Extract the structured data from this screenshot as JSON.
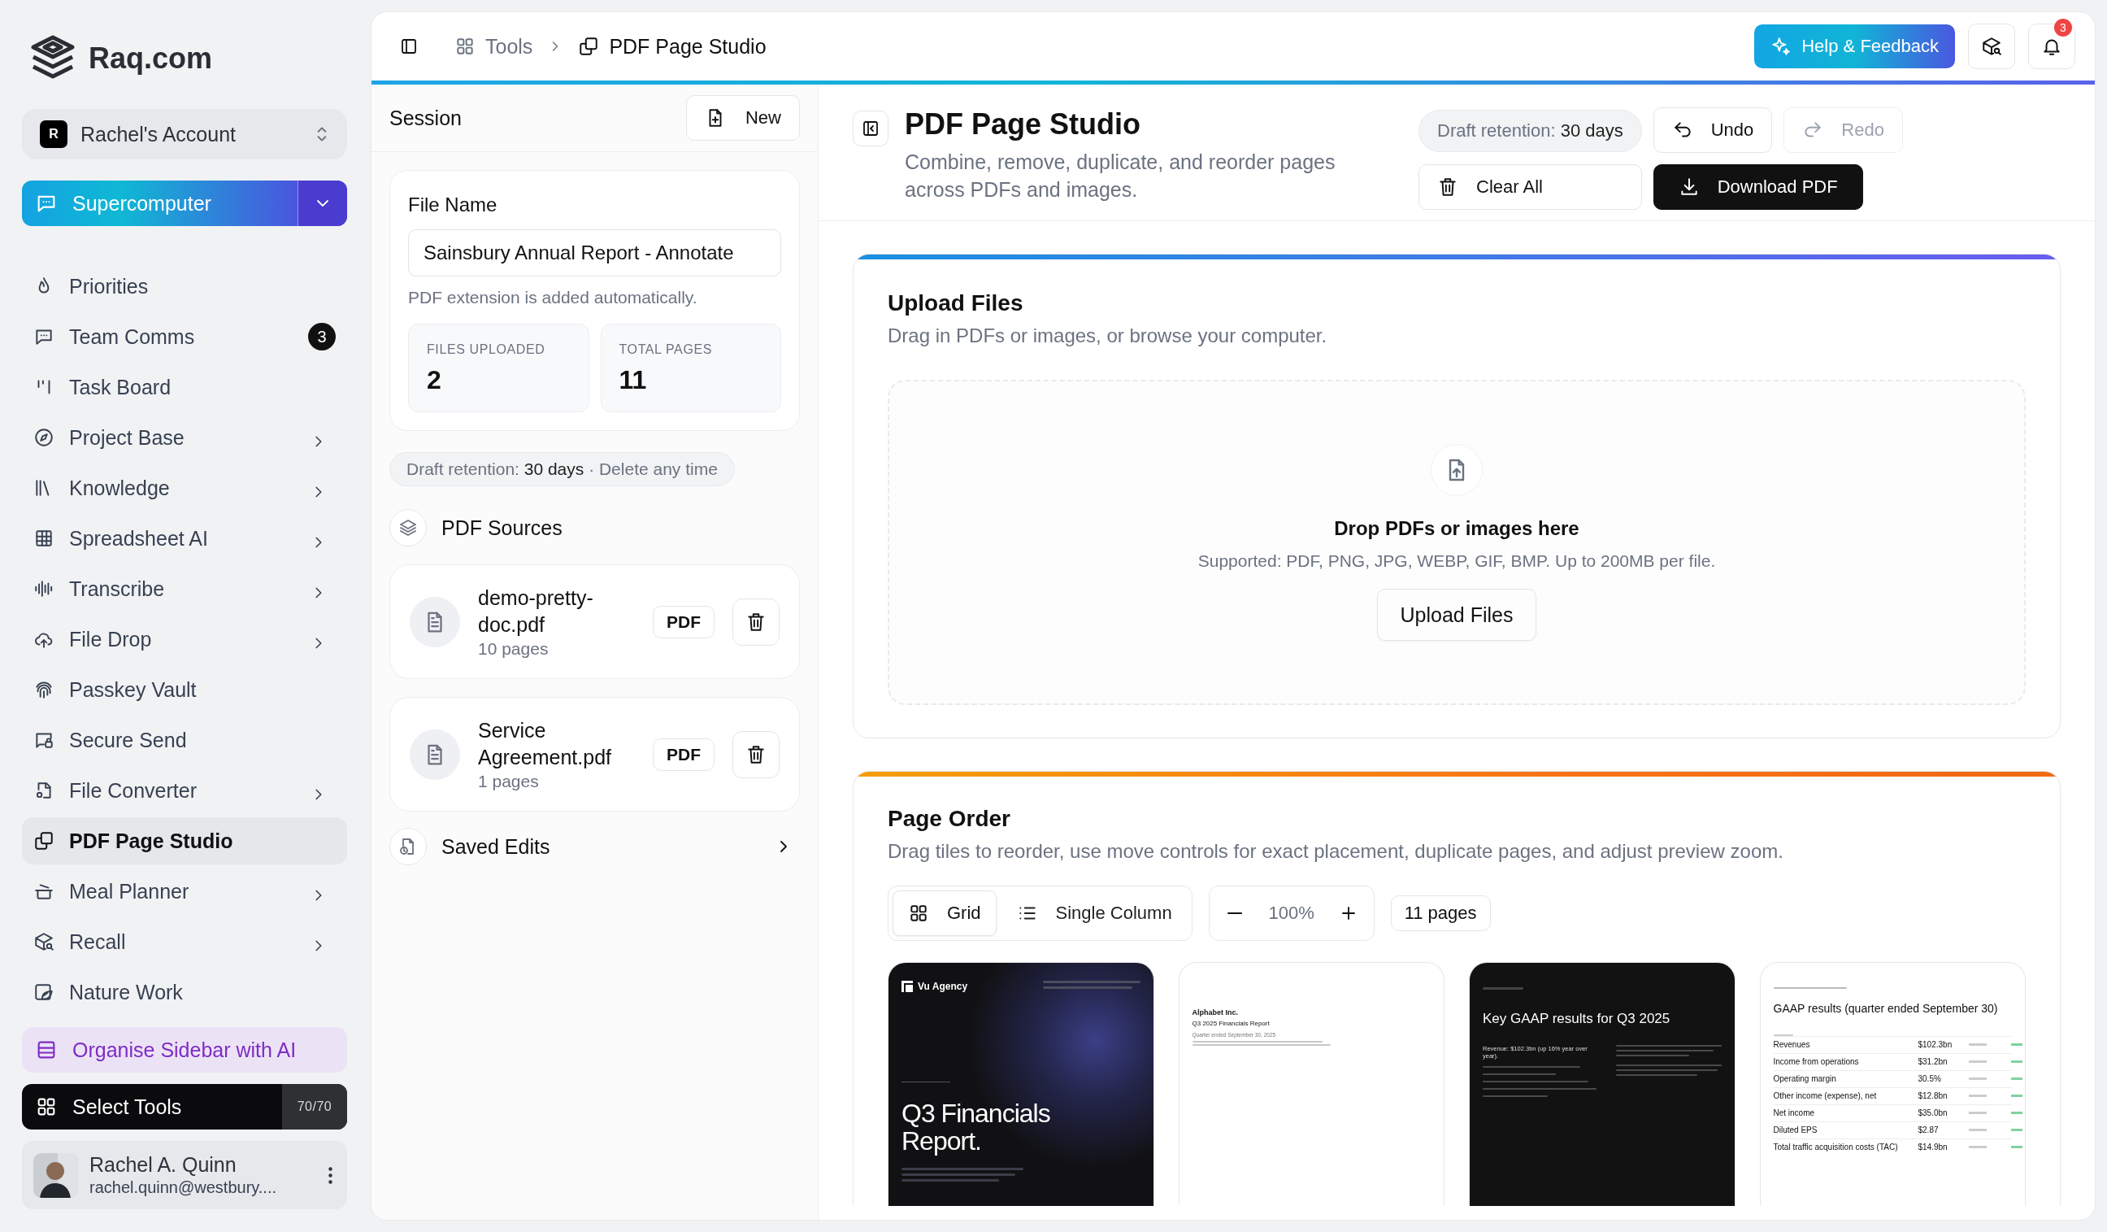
{
  "brand": {
    "name": "Raq.com"
  },
  "account": {
    "initial": "R",
    "name": "Rachel's Account"
  },
  "primary_tool": {
    "label": "Supercomputer"
  },
  "nav": [
    {
      "label": "Priorities",
      "expandable": false,
      "selected": false
    },
    {
      "label": "Team Comms",
      "expandable": false,
      "selected": false,
      "badge": "3"
    },
    {
      "label": "Task Board",
      "expandable": false,
      "selected": false
    },
    {
      "label": "Project Base",
      "expandable": true,
      "selected": false
    },
    {
      "label": "Knowledge",
      "expandable": true,
      "selected": false
    },
    {
      "label": "Spreadsheet AI",
      "expandable": true,
      "selected": false
    },
    {
      "label": "Transcribe",
      "expandable": true,
      "selected": false
    },
    {
      "label": "File Drop",
      "expandable": true,
      "selected": false
    },
    {
      "label": "Passkey Vault",
      "expandable": false,
      "selected": false
    },
    {
      "label": "Secure Send",
      "expandable": false,
      "selected": false
    },
    {
      "label": "File Converter",
      "expandable": true,
      "selected": false
    },
    {
      "label": "PDF Page Studio",
      "expandable": false,
      "selected": true
    },
    {
      "label": "Meal Planner",
      "expandable": true,
      "selected": false
    },
    {
      "label": "Recall",
      "expandable": true,
      "selected": false
    },
    {
      "label": "Nature Work",
      "expandable": false,
      "selected": false
    }
  ],
  "organise": {
    "label": "Organise Sidebar with AI"
  },
  "select_tools": {
    "label": "Select Tools",
    "count": "70/70"
  },
  "user": {
    "name": "Rachel A. Quinn",
    "email": "rachel.quinn@westbury...."
  },
  "breadcrumb": [
    {
      "label": "Tools"
    },
    {
      "label": "PDF Page Studio"
    }
  ],
  "top_actions": {
    "help": "Help & Feedback",
    "notification_count": "3"
  },
  "session": {
    "title": "Session",
    "new_button": "New",
    "file_name_label": "File Name",
    "file_name_value": "Sainsbury Annual Report - Annotate",
    "hint": "PDF extension is added automatically.",
    "stats": [
      {
        "label": "FILES UPLOADED",
        "value": "2"
      },
      {
        "label": "TOTAL PAGES",
        "value": "11"
      }
    ],
    "retention": "Draft retention: **30 days** · Delete any time",
    "sources_title": "PDF Sources",
    "sources": [
      {
        "name": "demo-pretty-doc.pdf",
        "pages": "10 pages",
        "type": "PDF"
      },
      {
        "name": "Service Agreement.pdf",
        "pages": "1 pages",
        "type": "PDF"
      }
    ],
    "saved_edits": "Saved Edits"
  },
  "header": {
    "title": "PDF Page Studio",
    "subtitle": "Combine, remove, duplicate, and reorder pages across PDFs and images.",
    "retention": "Draft retention: **30 days**",
    "buttons": [
      {
        "kind": "undo",
        "label": "Undo",
        "disabled": false
      },
      {
        "kind": "redo",
        "label": "Redo",
        "disabled": true
      },
      {
        "kind": "clear",
        "label": "Clear All",
        "disabled": false
      },
      {
        "kind": "download",
        "label": "Download PDF",
        "disabled": false
      }
    ]
  },
  "upload": {
    "title": "Upload Files",
    "subtitle": "Drag in PDFs or images, or browse your computer.",
    "drop_title": "Drop PDFs or images here",
    "supported": "Supported: PDF, PNG, JPG, WEBP, GIF, BMP. Up to 200MB per file.",
    "button": "Upload Files"
  },
  "page_order": {
    "title": "Page Order",
    "subtitle": "Drag tiles to reorder, use move controls for exact placement, duplicate pages, and adjust preview zoom.",
    "views": [
      {
        "label": "Grid",
        "selected": true
      },
      {
        "label": "Single Column",
        "selected": false
      }
    ],
    "zoom": "100%",
    "count": "11 pages",
    "pages": [
      {
        "kind": "cover",
        "brand": "Vu Agency",
        "title": "Q3 Financials Report."
      },
      {
        "kind": "title",
        "lines": [
          "Alphabet Inc.",
          "Q3 2025 Financials Report",
          "Quarter ended September 30, 2025"
        ]
      },
      {
        "kind": "summary",
        "title": "Key GAAP results for Q3 2025",
        "lines": [
          "Revenue: $102.3bn (up 16% year over year)."
        ]
      },
      {
        "kind": "table",
        "title": "GAAP results (quarter ended September 30)",
        "rows": [
          {
            "metric": "Revenues",
            "value": "$102.3bn"
          },
          {
            "metric": "Income from operations",
            "value": "$31.2bn"
          },
          {
            "metric": "Operating margin",
            "value": "30.5%"
          },
          {
            "metric": "Other income (expense), net",
            "value": "$12.8bn"
          },
          {
            "metric": "Net income",
            "value": "$35.0bn"
          },
          {
            "metric": "Diluted EPS",
            "value": "$2.87"
          },
          {
            "metric": "Total traffic acquisition costs (TAC)",
            "value": "$14.9bn"
          }
        ]
      }
    ]
  }
}
